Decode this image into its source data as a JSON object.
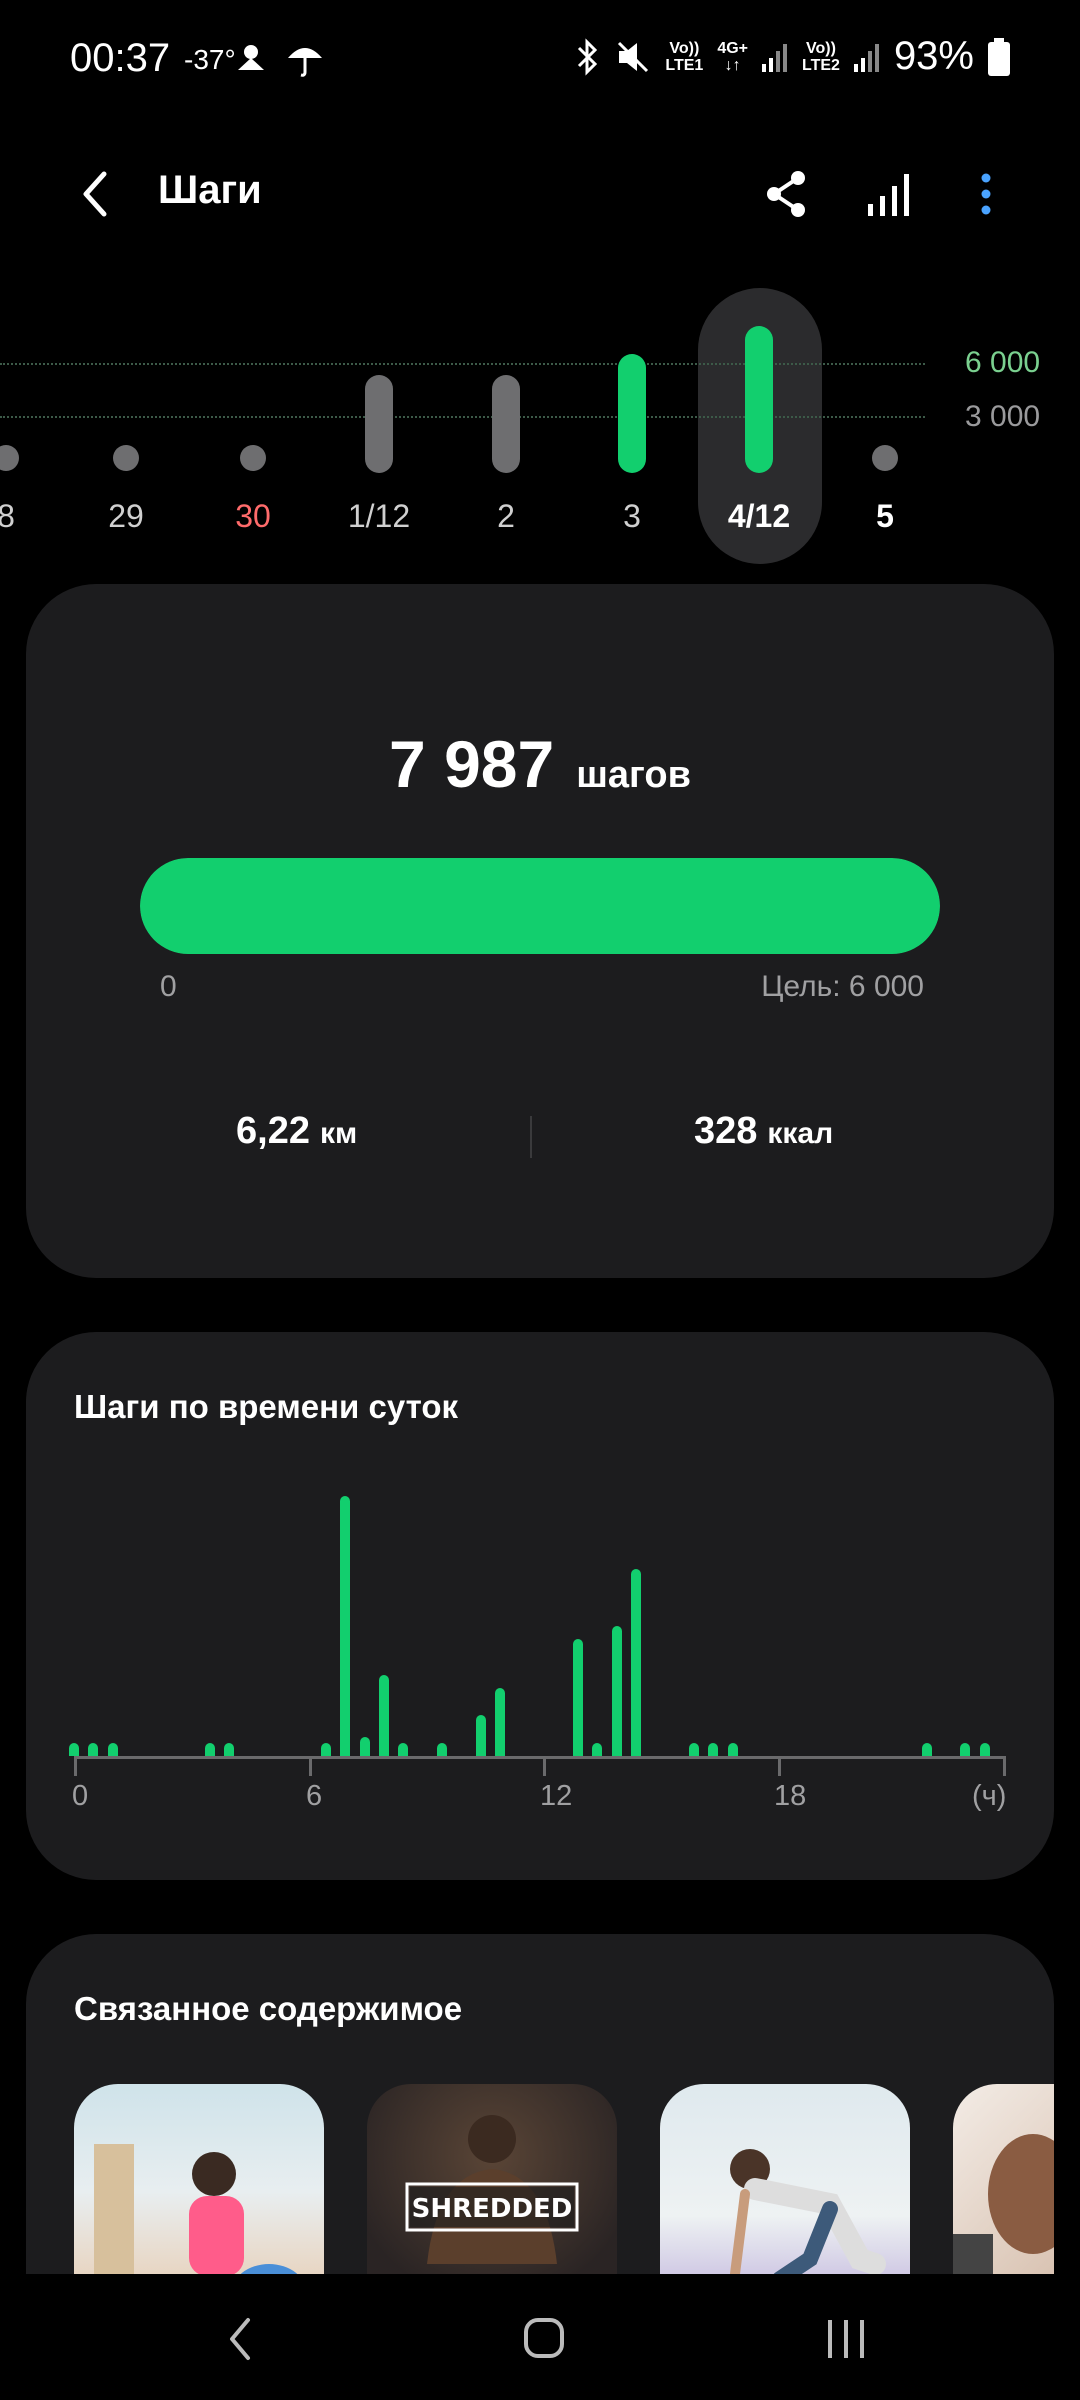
{
  "status_bar": {
    "time": "00:37",
    "temp": "-37°",
    "net1": "Vo))\nLTE1",
    "net2": "4G+\n↓↑",
    "net3": "Vo))\nLTE2",
    "battery": "93%",
    "icons": [
      "sunrise-weather-icon",
      "umbrella-icon",
      "bluetooth-icon",
      "mute-icon",
      "signal-icon",
      "battery-icon"
    ]
  },
  "header": {
    "title": "Шаги",
    "icons": [
      "back-arrow-icon",
      "share-icon",
      "stats-bars-icon",
      "more-vertical-icon"
    ]
  },
  "week_chart": {
    "labels": [
      "8",
      "29",
      "30",
      "1/12",
      "2",
      "3",
      "4/12",
      "5"
    ],
    "guides": [
      "6 000",
      "3 000"
    ],
    "selected": "4/12",
    "goal_color": "#12cf6e",
    "muted_color": "#6e6e70",
    "weekend_color": "#ff6b6b"
  },
  "summary": {
    "steps": "7 987",
    "steps_unit": "шагов",
    "progress_percent": 100,
    "min_label": "0",
    "goal_label": "Цель: 6 000",
    "distance": "6,22",
    "distance_unit": "км",
    "calories": "328",
    "calories_unit": "ккал"
  },
  "hourly": {
    "title": "Шаги по времени суток",
    "axis_labels": [
      "0",
      "6",
      "12",
      "18",
      "(ч)"
    ]
  },
  "chart_data": {
    "type": "bar",
    "title": "Шаги по времени суток",
    "xlabel": "(ч)",
    "x": [
      0,
      0.5,
      1,
      3.5,
      4,
      6.5,
      7,
      7.5,
      8,
      8.5,
      9.5,
      10.5,
      11,
      13,
      13.5,
      14,
      14.5,
      16,
      16.5,
      17,
      22,
      23,
      23.5
    ],
    "values": [
      8,
      8,
      8,
      8,
      8,
      8,
      160,
      12,
      50,
      8,
      8,
      25,
      42,
      72,
      8,
      80,
      115,
      8,
      8,
      8,
      8,
      8,
      8
    ],
    "xlim": [
      0,
      24
    ]
  },
  "related": {
    "title": "Связанное содержимое",
    "items": [
      {
        "name": "related-thumb-stretch",
        "label": ""
      },
      {
        "name": "related-thumb-shredded",
        "label": "SHREDDED"
      },
      {
        "name": "related-thumb-mountain-climber",
        "label": ""
      },
      {
        "name": "related-thumb-arm",
        "label": ""
      }
    ]
  },
  "nav": {
    "icons": [
      "nav-back-icon",
      "nav-home-icon",
      "nav-recents-icon"
    ]
  }
}
